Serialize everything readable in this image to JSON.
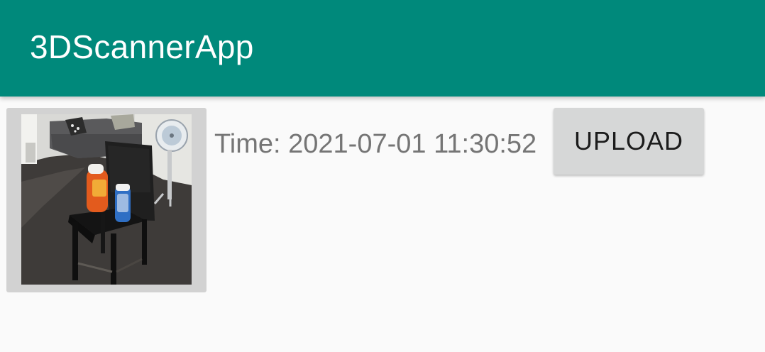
{
  "app_bar": {
    "title": "3DScannerApp",
    "color": "#00897b"
  },
  "scans": [
    {
      "thumbnail": "scan-photo",
      "time_text": "Time: 2021-07-01 11:30:52",
      "upload_label": "UPLOAD"
    }
  ]
}
